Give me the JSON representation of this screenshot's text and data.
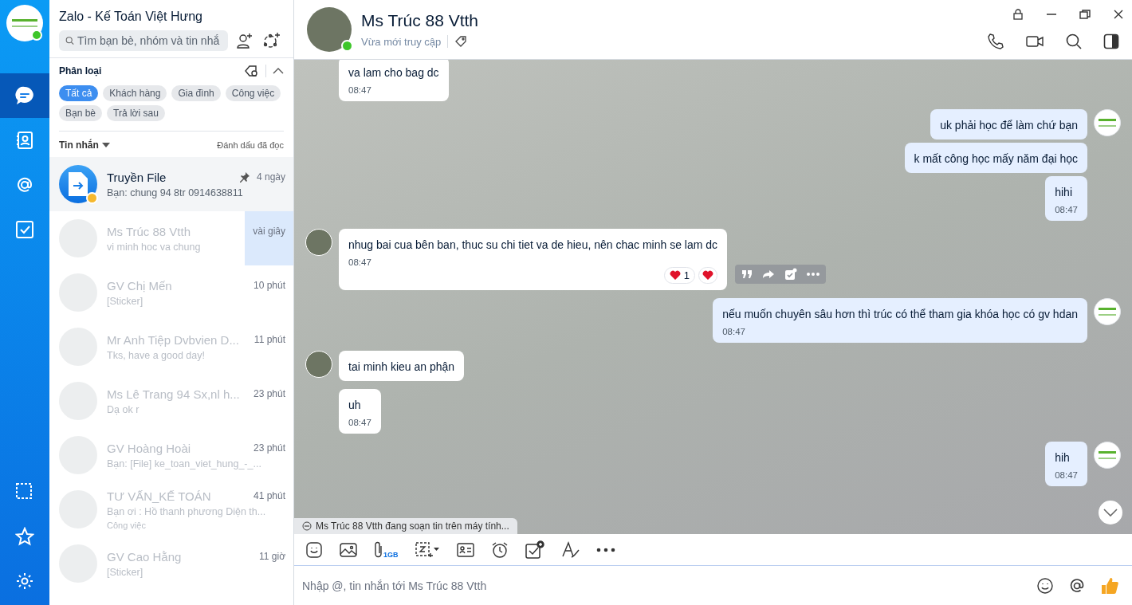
{
  "sidebar": {
    "avatar_online": true,
    "items": [
      {
        "selected": true
      },
      {
        "selected": false
      },
      {
        "selected": false
      },
      {
        "selected": false
      }
    ]
  },
  "list_panel": {
    "title": "Zalo - Kế Toán Việt Hưng",
    "search": {
      "placeholder": "Tìm bạn bè, nhóm và tin nhắ"
    },
    "filter": {
      "title": "Phân loại",
      "expanded": true,
      "tags": [
        {
          "label": "Tất cả",
          "selected": true
        },
        {
          "label": "Khách hàng",
          "selected": false
        },
        {
          "label": "Gia đình",
          "selected": false
        },
        {
          "label": "Công việc",
          "selected": false
        },
        {
          "label": "Bạn bè",
          "selected": false
        },
        {
          "label": "Trả lời sau",
          "selected": false
        }
      ]
    },
    "messages_header": {
      "label": "Tin nhắn",
      "action": "Đánh dấu đã đọc"
    },
    "conversations": [
      {
        "kind": "file",
        "name": "Truyền File",
        "preview": "Bạn: chung 94 8tr 0914638811",
        "time": "4 ngày",
        "pinned": true,
        "selected": false,
        "faded": false
      },
      {
        "kind": "person",
        "name": "Ms Trúc 88 Vtth",
        "preview": "vi minh hoc va chung",
        "time": "vài giây",
        "pinned": false,
        "selected": true,
        "faded": true
      },
      {
        "kind": "person",
        "name": "GV Chị Mến",
        "preview": "[Sticker]",
        "time": "10 phút",
        "pinned": false,
        "selected": false,
        "faded": true
      },
      {
        "kind": "person",
        "name": "Mr Anh Tiệp Dvbvien D...",
        "preview": "Tks, have a good day!",
        "time": "11 phút",
        "pinned": false,
        "selected": false,
        "faded": true
      },
      {
        "kind": "person",
        "name": "Ms Lê Trang 94 Sx,nl h...",
        "preview": "Dạ ok r",
        "time": "23 phút",
        "pinned": false,
        "selected": false,
        "faded": true
      },
      {
        "kind": "person",
        "name": "GV Hoàng Hoài",
        "preview": "Bạn: [File] ke_toan_viet_hung_-_...",
        "time": "23 phút",
        "pinned": false,
        "selected": false,
        "faded": true
      },
      {
        "kind": "person",
        "name": "TƯ VẤN_KẾ TOÁN",
        "preview": "Bạn ơi : Hồ thanh phương Diện th...",
        "tag": "Công việc",
        "time": "41 phút",
        "pinned": false,
        "selected": false,
        "faded": true
      },
      {
        "kind": "person",
        "name": "GV Cao Hằng",
        "preview": "[Sticker]",
        "time": "11 giờ",
        "pinned": false,
        "selected": false,
        "faded": true
      }
    ]
  },
  "chat": {
    "contact": {
      "name": "Ms Trúc 88 Vtth",
      "status": "Vừa mới truy cập",
      "online": true
    },
    "messages": [
      {
        "kind": "incoming",
        "text": "va lam cho bag dc",
        "time": "08:47",
        "avatar": false
      },
      {
        "kind": "outgoing",
        "text": "uk phải học để làm chứ bạn",
        "avatar": true
      },
      {
        "kind": "outgoing",
        "text": "k mất công học mấy năm đại học",
        "avatar": false
      },
      {
        "kind": "outgoing",
        "text": "hihi",
        "time": "08:47",
        "avatar": false
      },
      {
        "kind": "incoming",
        "text": "nhug bai cua bên ban, thuc su chi tiet va de hieu, nên chac minh se lam dc",
        "time": "08:47",
        "avatar": true,
        "reaction_count": "1",
        "hovered": true
      },
      {
        "kind": "outgoing",
        "text": "nếu muốn chuyên sâu hơn thì trúc có thể tham gia khóa học có gv hdan",
        "time": "08:47",
        "avatar": true
      },
      {
        "kind": "incoming",
        "text": "tai minh kieu an phận",
        "avatar": true
      },
      {
        "kind": "incoming",
        "text": "uh",
        "time": "08:47",
        "avatar": false
      },
      {
        "kind": "outgoing",
        "text": "hih",
        "time": "08:47",
        "avatar": true
      }
    ],
    "typing": "Ms Trúc 88 Vtth  đang soạn tin trên máy tính...",
    "attachment_limit": "1GB",
    "input": {
      "placeholder": "Nhập @, tin nhắn tới Ms Trúc 88 Vtth"
    }
  }
}
